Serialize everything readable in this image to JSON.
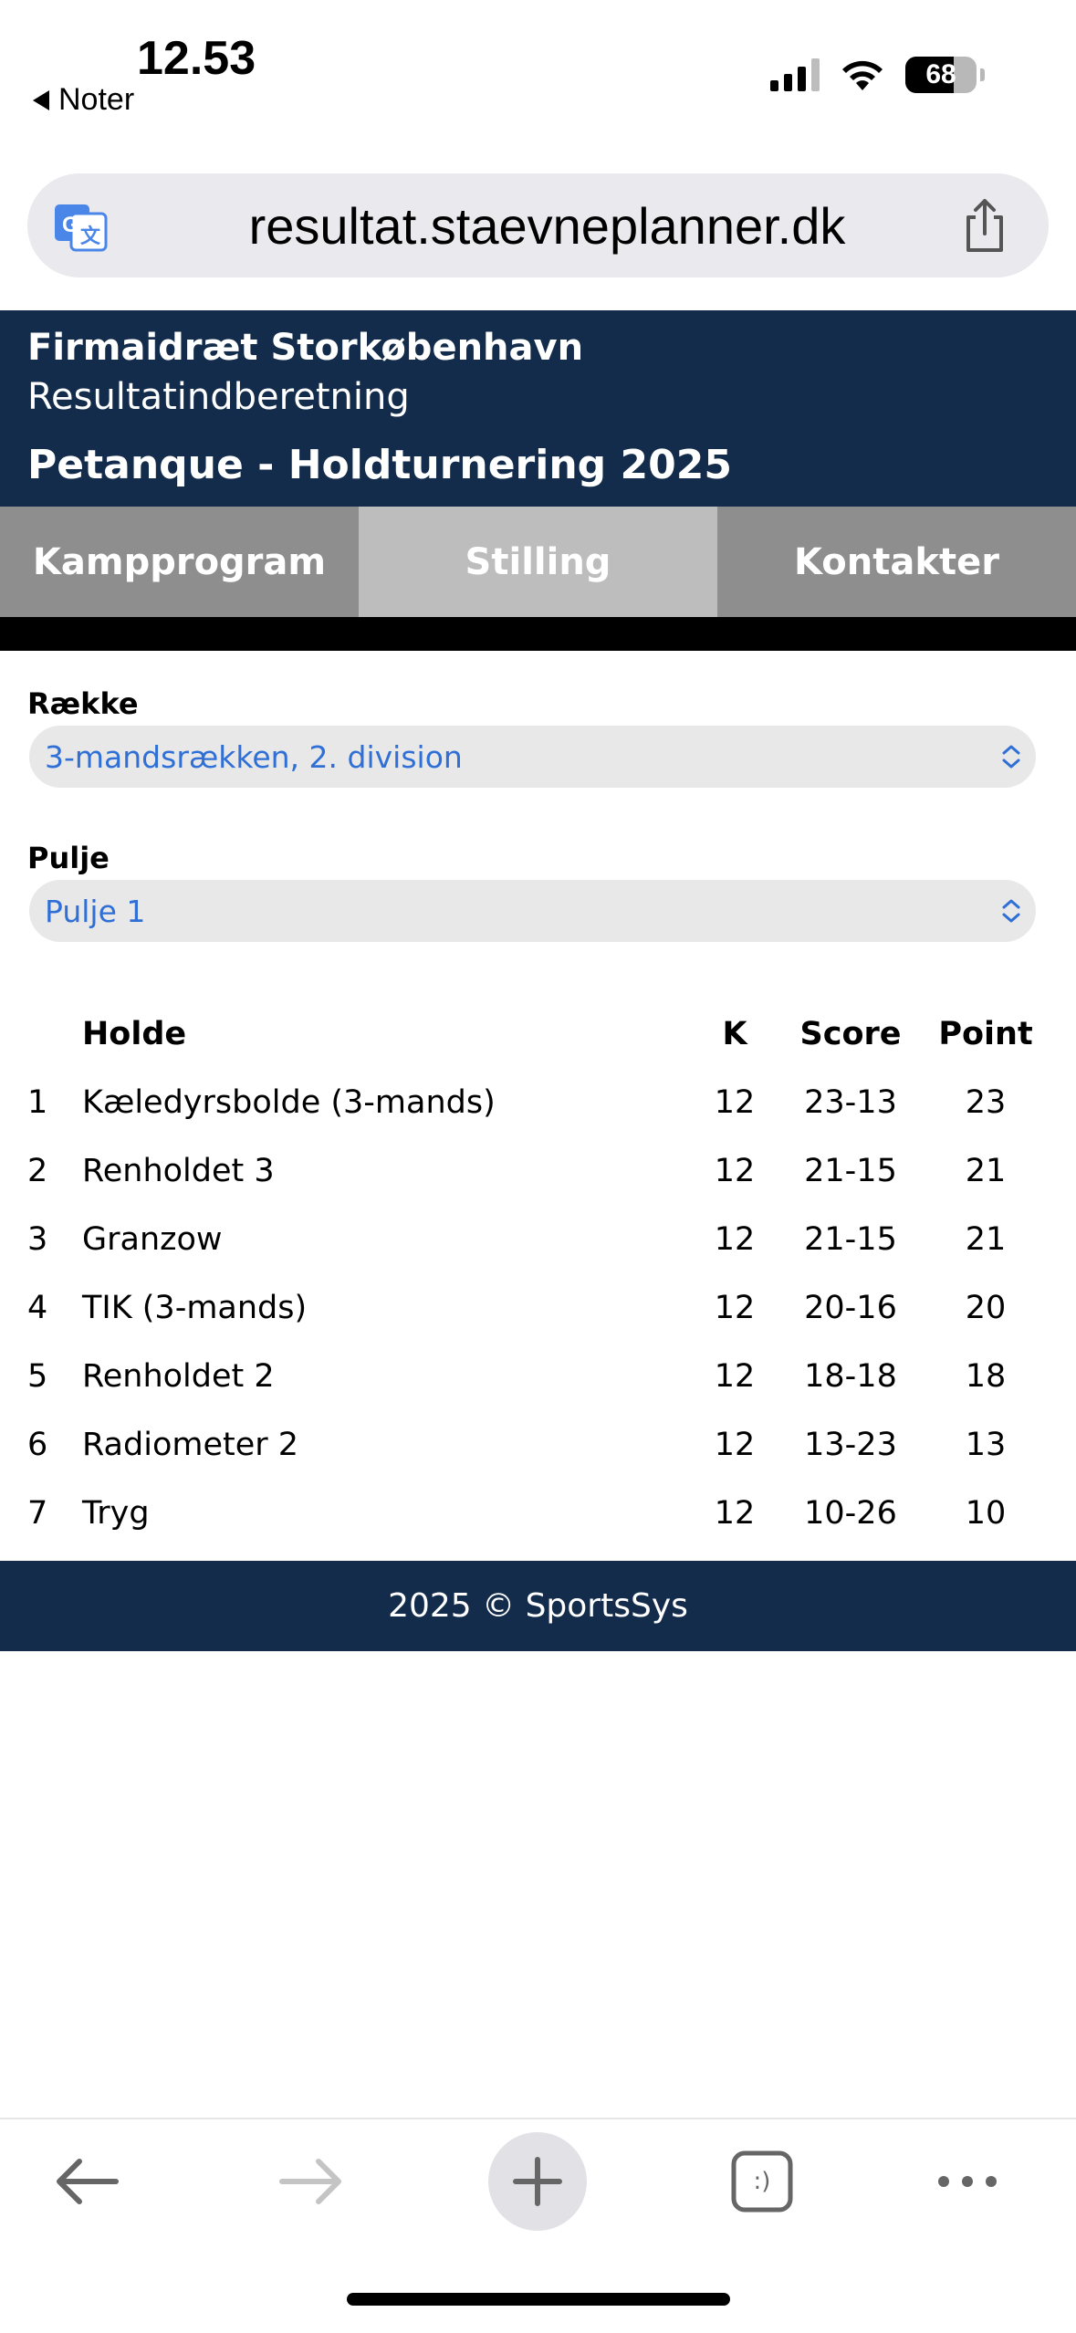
{
  "status_bar": {
    "time": "12.53",
    "back_label": "Noter",
    "battery": "68"
  },
  "browser": {
    "url": "resultat.staevneplanner.dk"
  },
  "header": {
    "org_name": "Firmaidræt Storkøbenhavn",
    "subtitle": "Resultatindberetning",
    "tournament": "Petanque - Holdturnering 2025"
  },
  "tabs": [
    {
      "label": "Kampprogram",
      "active": false
    },
    {
      "label": "Stilling",
      "active": true
    },
    {
      "label": "Kontakter",
      "active": false
    }
  ],
  "filters": {
    "row_label": "Række",
    "row_value": "3-mandsrækken, 2. division",
    "pool_label": "Pulje",
    "pool_value": "Pulje 1"
  },
  "table": {
    "headers": {
      "rank": "",
      "team": "Holde",
      "k": "K",
      "score": "Score",
      "point": "Point"
    },
    "rows": [
      {
        "rank": "1",
        "team": "Kæledyrsbolde (3-mands)",
        "k": "12",
        "score": "23-13",
        "point": "23"
      },
      {
        "rank": "2",
        "team": "Renholdet 3",
        "k": "12",
        "score": "21-15",
        "point": "21"
      },
      {
        "rank": "3",
        "team": "Granzow",
        "k": "12",
        "score": "21-15",
        "point": "21"
      },
      {
        "rank": "4",
        "team": "TIK (3-mands)",
        "k": "12",
        "score": "20-16",
        "point": "20"
      },
      {
        "rank": "5",
        "team": "Renholdet 2",
        "k": "12",
        "score": "18-18",
        "point": "18"
      },
      {
        "rank": "6",
        "team": "Radiometer 2",
        "k": "12",
        "score": "13-23",
        "point": "13"
      },
      {
        "rank": "7",
        "team": "Tryg",
        "k": "12",
        "score": "10-26",
        "point": "10"
      }
    ]
  },
  "footer": {
    "text": "2025 © SportsSys"
  },
  "toolbar": {
    "tabs_face": ":)"
  },
  "colors": {
    "header_bg": "#142c4b",
    "tab_bg": "#8e8e8e",
    "tab_active_bg": "#bdbdbd",
    "link_blue": "#2f6fd6"
  }
}
